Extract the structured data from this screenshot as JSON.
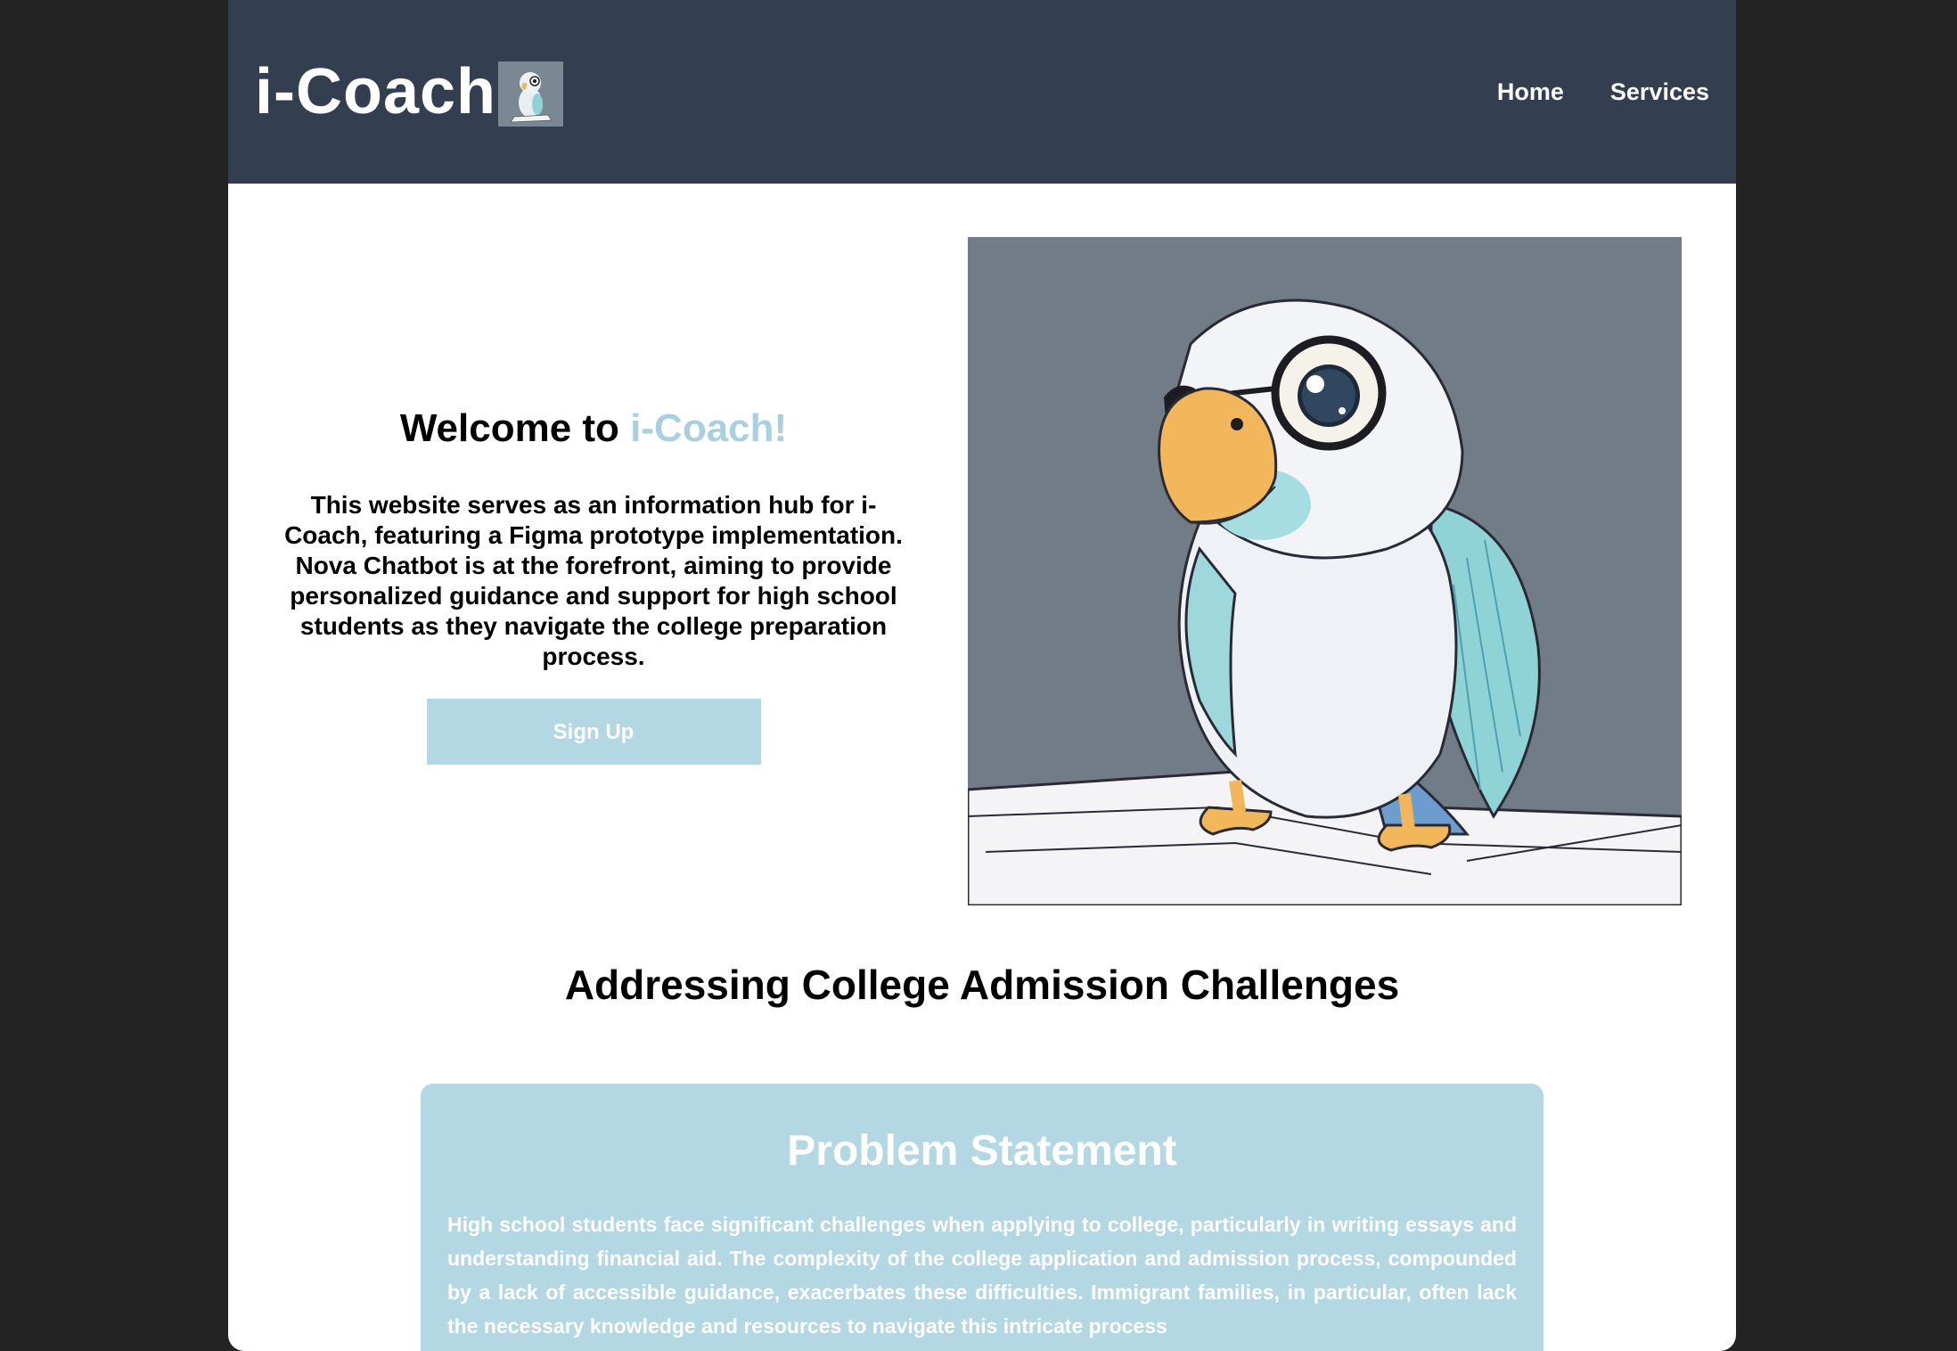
{
  "brand": {
    "name": "i-Coach"
  },
  "nav": {
    "items": [
      {
        "label": "Home"
      },
      {
        "label": "Services"
      }
    ]
  },
  "hero": {
    "title_prefix": "Welcome to ",
    "title_accent": "i-Coach!",
    "description": "This website serves as an information hub for i-Coach, featuring a Figma prototype implementation. Nova Chatbot is at the forefront, aiming to provide personalized guidance and support for high school students as they navigate the college preparation process.",
    "signup_label": "Sign Up",
    "image_icon": "parakeet-mascot"
  },
  "section": {
    "title": "Addressing College Admission Challenges"
  },
  "problem": {
    "title": "Problem Statement",
    "text": "High school students face significant challenges when applying to college, particularly in writing essays and understanding financial aid. The complexity of the college application and admission process, compounded by a lack of accessible guidance, exacerbates these difficulties. Immigrant families, in particular, often lack the necessary knowledge and resources to navigate this intricate process"
  },
  "colors": {
    "navbar": "#333f50",
    "accent": "#a8d0df",
    "card": "#b3d7e3"
  }
}
